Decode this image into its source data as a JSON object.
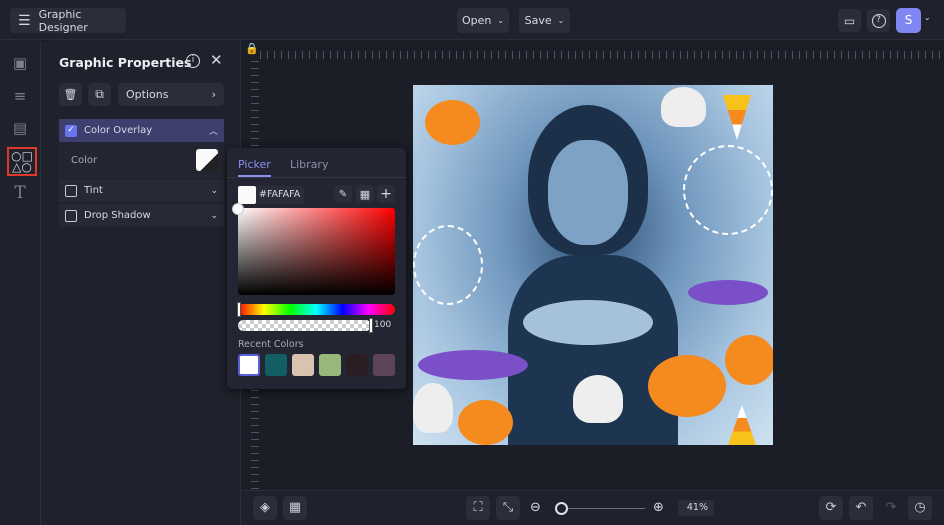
{
  "app": {
    "title": "Graphic Designer",
    "open_label": "Open",
    "save_label": "Save",
    "avatar_initial": "S"
  },
  "panel": {
    "title": "Graphic Properties",
    "options_label": "Options",
    "sections": [
      {
        "label": "Color Overlay",
        "checked": true
      },
      {
        "label": "Tint",
        "checked": false
      },
      {
        "label": "Drop Shadow",
        "checked": false
      }
    ],
    "color_label": "Color"
  },
  "picker": {
    "tabs": [
      "Picker",
      "Library"
    ],
    "hex": "#FAFAFA",
    "opacity": "100",
    "recent_label": "Recent Colors",
    "recent_colors": [
      "#ffffff",
      "#135e63",
      "#d8c3b0",
      "#97b878",
      "#2a1e24",
      "#5c4559"
    ]
  },
  "zoom": {
    "level": "41%",
    "fraction": 0.05
  },
  "colors": {
    "accent": "#5b5fd6",
    "highlight": "#e0392b"
  }
}
